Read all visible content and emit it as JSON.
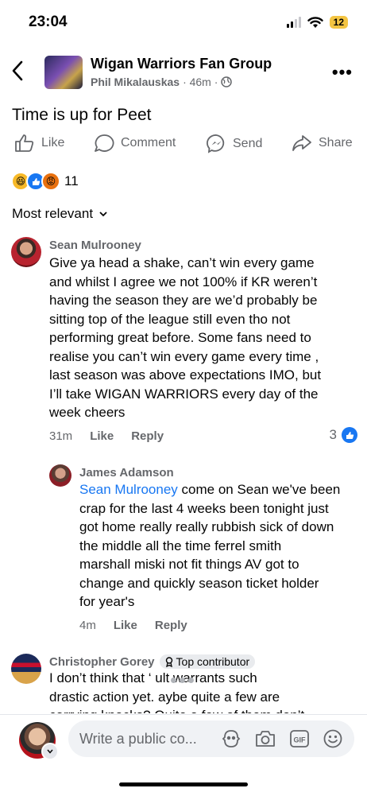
{
  "status": {
    "time": "23:04",
    "battery": "12"
  },
  "header": {
    "group_name": "Wigan Warriors Fan Group",
    "author": "Phil Mikalauskas",
    "age": "· 46m ·"
  },
  "post": {
    "title": "Time is up for Peet"
  },
  "actions": {
    "like": "Like",
    "comment": "Comment",
    "send": "Send",
    "share": "Share"
  },
  "reactions": {
    "count": "11"
  },
  "sort": {
    "label": "Most relevant"
  },
  "comments": [
    {
      "name": "Sean Mulrooney",
      "lines": [
        "Give ya head a shake, can’t win every game",
        "and whilst I agree we not 100% if KR weren’t",
        "having the season they are we’d probably be",
        "sitting top of the league still even tho not",
        "performing great before. Some fans need to",
        "realise you can’t win every game every time ,",
        "last season was above expectations IMO, but",
        "I’ll take WIGAN WARRIORS every day of the",
        "week cheers"
      ],
      "time": "31m",
      "like": "Like",
      "reply": "Reply",
      "likes": "3"
    },
    {
      "name": "James Adamson",
      "mention": "Sean Mulrooney",
      "first_rest": " come on Sean we've been",
      "lines": [
        "crap for the last 4 weeks been tonight just",
        "got home really really rubbish sick of down",
        "the middle all the time ferrel smith",
        "marshall miski not fit  things AV got to",
        "change and quickly season ticket holder",
        "for year's"
      ],
      "time": "4m",
      "like": "Like",
      "reply": "Reply"
    },
    {
      "name": "Christopher Gorey",
      "badge": "Top contributor",
      "lines": [
        "I don’t think that ‘          ult warrants such",
        "drastic action yet.      aybe quite a few are",
        "carrying knocks? Quite a few of them don’t"
      ]
    }
  ],
  "composer": {
    "placeholder": "Write a public co..."
  },
  "colors": {
    "accent": "#1877f2",
    "secondary_text": "#65676b"
  }
}
